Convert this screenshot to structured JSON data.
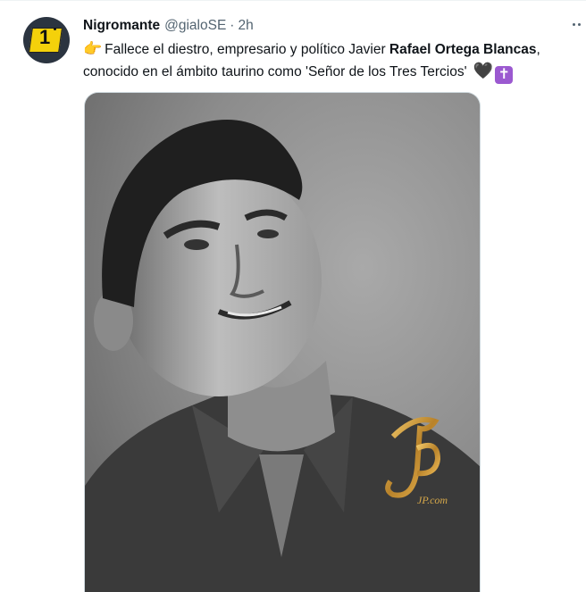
{
  "tweet": {
    "display_name": "Nigromante",
    "handle": "@gialoSE",
    "separator": "·",
    "time": "2h",
    "avatar_number": "1",
    "text": {
      "line1_pre": "Fallece el diestro, empresario y político Javier ",
      "line1_bold": "Rafael Ortega Blancas",
      "line1_post": ",",
      "line2": "conocido en el ámbito taurino como 'Señor de los Tres Tercios'",
      "pointer_emoji": "👉",
      "heart_emoji": "🖤",
      "cross_emoji": "✝"
    },
    "media": {
      "description_icon": "photo-portrait",
      "watermark": "JP.com"
    }
  },
  "colors": {
    "text": "#0f1419",
    "secondary": "#536471",
    "border": "#cfd9de",
    "badge_yellow": "#f4d10b",
    "cross_purple": "#9b59d0"
  }
}
